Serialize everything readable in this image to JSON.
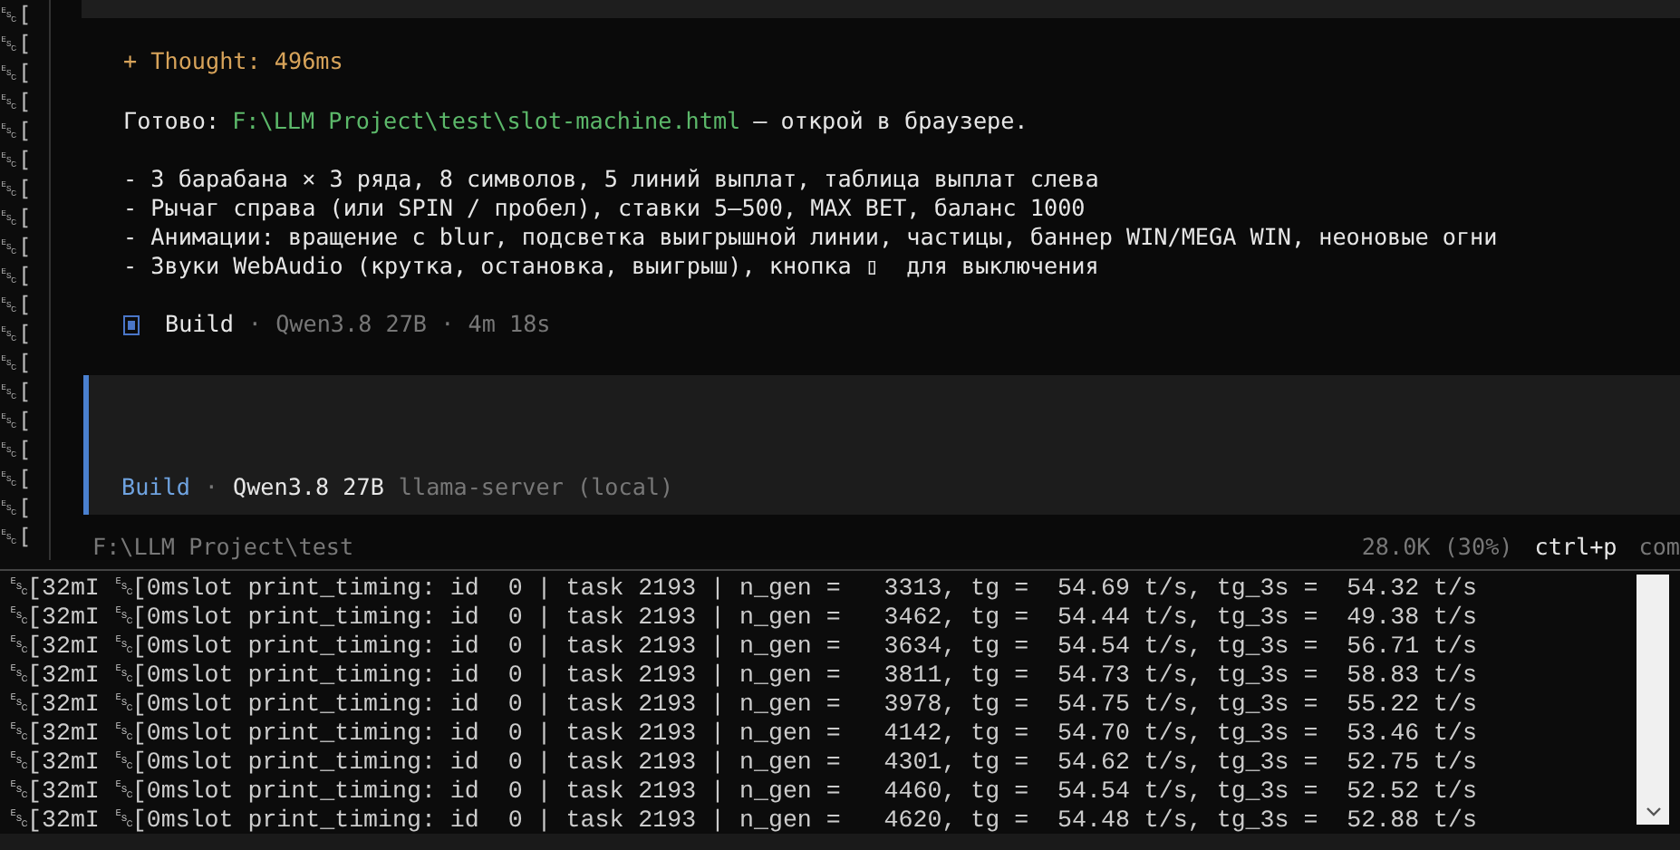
{
  "gutter_lines": [
    "␛[",
    "␛[",
    "␛[",
    "␛[",
    "␛[",
    "␛[",
    "␛[",
    "␛[",
    "␛[",
    "␛[",
    "␛[",
    "␛[",
    "␛[",
    "␛[",
    "␛[",
    "␛[",
    "␛[",
    "␛[",
    "␛["
  ],
  "session": {
    "thought": "+ Thought: 496ms",
    "done_prefix": "Готово:",
    "path": "F:\\LLM Project\\test\\slot-machine.html",
    "done_suffix": "— открой в браузере.",
    "bullets": [
      "- 3 барабана × 3 ряда, 8 символов, 5 линий выплат, таблица выплат слева",
      "- Рычаг справа (или SPIN / пробел), ставки 5–500, MAX BET, баланс 1000",
      "- Анимации: вращение с blur, подсветка выигрышной линии, частицы, баннер WIN/MEGA WIN, неоновые огни",
      "- Звуки WebAudio (крутка, остановка, выигрыш), кнопка ▯  для выключения"
    ],
    "build_summary": {
      "agent": "Build",
      "details": "· Qwen3.8 27B · 4m 18s"
    }
  },
  "prompt": {
    "agent": "Build",
    "separator": "·",
    "model": "Qwen3.8 27B",
    "provider": "llama-server (local)"
  },
  "status_bar": {
    "path": "F:\\LLM Project\\test",
    "context": "28.0K (30%)",
    "shortcut": "ctrl+p",
    "shortcut_label": "com"
  },
  "log_lines": [
    "␛[32mI ␛[0mslot print_timing: id  0 | task 2193 | n_gen =   3313, tg =  54.69 t/s, tg_3s =  54.32 t/s",
    "␛[32mI ␛[0mslot print_timing: id  0 | task 2193 | n_gen =   3462, tg =  54.44 t/s, tg_3s =  49.38 t/s",
    "␛[32mI ␛[0mslot print_timing: id  0 | task 2193 | n_gen =   3634, tg =  54.54 t/s, tg_3s =  56.71 t/s",
    "␛[32mI ␛[0mslot print_timing: id  0 | task 2193 | n_gen =   3811, tg =  54.73 t/s, tg_3s =  58.83 t/s",
    "␛[32mI ␛[0mslot print_timing: id  0 | task 2193 | n_gen =   3978, tg =  54.75 t/s, tg_3s =  55.22 t/s",
    "␛[32mI ␛[0mslot print_timing: id  0 | task 2193 | n_gen =   4142, tg =  54.70 t/s, tg_3s =  53.46 t/s",
    "␛[32mI ␛[0mslot print_timing: id  0 | task 2193 | n_gen =   4301, tg =  54.62 t/s, tg_3s =  52.75 t/s",
    "␛[32mI ␛[0mslot print_timing: id  0 | task 2193 | n_gen =   4460, tg =  54.54 t/s, tg_3s =  52.52 t/s",
    "␛[32mI ␛[0mslot print_timing: id  0 | task 2193 | n_gen =   4620, tg =  54.48 t/s, tg_3s =  52.88 t/s"
  ]
}
